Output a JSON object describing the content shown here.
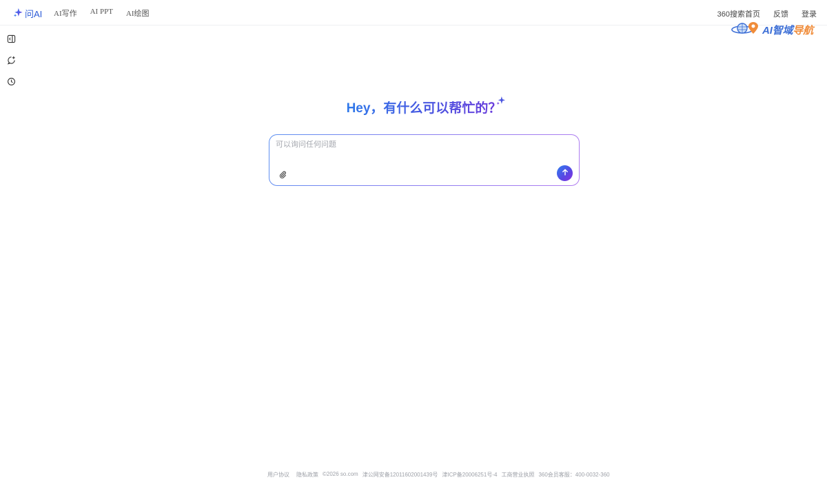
{
  "brand": {
    "label": "问AI",
    "icon": "sparkle-star-icon"
  },
  "nav": {
    "items": [
      {
        "label": "AI写作"
      },
      {
        "label": "AI PPT"
      },
      {
        "label": "AI绘图"
      }
    ]
  },
  "header_links": {
    "home": "360搜索首页",
    "feedback": "反馈",
    "login": "登录"
  },
  "watermark": {
    "icon": "globe-pin-icon",
    "ai": "AI",
    "zhiyu": "智域",
    "daohang": "导航"
  },
  "sidebar": {
    "items": [
      {
        "icon": "panel-toggle-icon"
      },
      {
        "icon": "new-chat-icon"
      },
      {
        "icon": "history-clock-icon"
      }
    ]
  },
  "greeting": {
    "text": "Hey，有什么可以帮忙的？"
  },
  "composer": {
    "placeholder": "可以询问任何问题",
    "value": "",
    "attach_icon": "paperclip-icon",
    "send_icon": "arrow-up-icon"
  },
  "footer": {
    "user_agreement": "用户协议",
    "privacy": "隐私政策",
    "copyright": "©2026 so.com",
    "police": "津公网安备12011602001439号",
    "icp": "津ICP备20006251号-4",
    "license": "工商营业执照",
    "service": "360会员客服：400-0032-360"
  },
  "colors": {
    "brand_blue": "#2b5bd7",
    "gradient_start": "#2f79ea",
    "gradient_end": "#6d3bdc",
    "watermark_orange": "#f08c3a"
  }
}
